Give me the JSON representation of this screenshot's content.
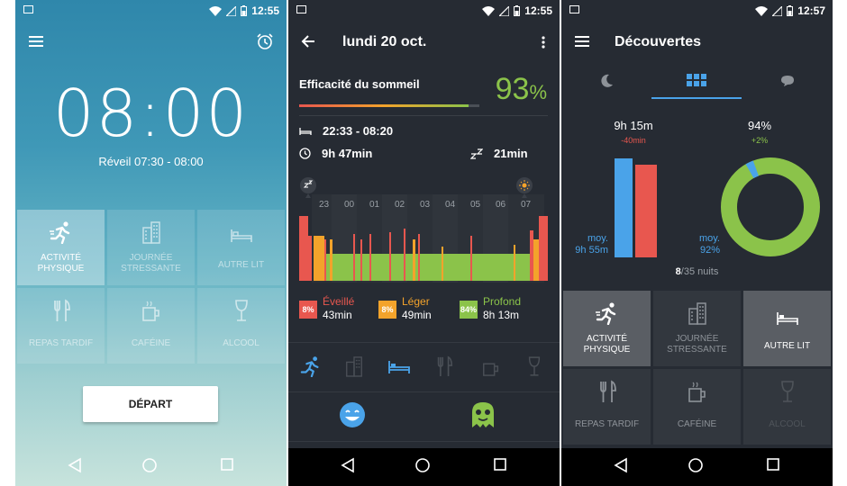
{
  "status": {
    "time1": "12:55",
    "time2": "12:55",
    "time3": "12:57"
  },
  "screen1": {
    "alarm_time": "08:00",
    "wake_window": "Réveil 07:30 - 08:00",
    "tiles": [
      {
        "label": "ACTIVITÉ PHYSIQUE",
        "icon": "running-icon",
        "active": true
      },
      {
        "label": "JOURNÉE STRESSANTE",
        "icon": "building-icon",
        "active": false
      },
      {
        "label": "AUTRE LIT",
        "icon": "bed-icon",
        "active": false
      },
      {
        "label": "REPAS TARDIF",
        "icon": "fork-knife-icon",
        "active": false
      },
      {
        "label": "CAFÉINE",
        "icon": "coffee-icon",
        "active": false
      },
      {
        "label": "ALCOOL",
        "icon": "wine-glass-icon",
        "active": false
      }
    ],
    "start_label": "DÉPART"
  },
  "screen2": {
    "title": "lundi 20 oct.",
    "efficiency_label": "Efficacité du sommeil",
    "efficiency_value": "93",
    "efficiency_unit": "%",
    "time_range": "22:33 - 08:20",
    "duration": "9h 47min",
    "fall_asleep": "21min",
    "hours": [
      "23",
      "00",
      "01",
      "02",
      "03",
      "04",
      "05",
      "06",
      "07"
    ],
    "legend": [
      {
        "pct": "8%",
        "name": "Éveillé",
        "time": "43min",
        "color": "#e8574f"
      },
      {
        "pct": "8%",
        "name": "Léger",
        "time": "49min",
        "color": "#f3a32b"
      },
      {
        "pct": "84%",
        "name": "Profond",
        "time": "8h 13m",
        "color": "#8bc34a"
      }
    ]
  },
  "screen3": {
    "title": "Découvertes",
    "duration_value": "9h 15m",
    "duration_delta": "-40min",
    "duration_avg_label": "moy.",
    "duration_avg": "9h 55m",
    "eff_value": "94%",
    "eff_delta": "+2%",
    "eff_avg_label": "moy.",
    "eff_avg": "92%",
    "nights_count": "8",
    "nights_total": "/35 nuits",
    "tiles": [
      {
        "label": "ACTIVITÉ PHYSIQUE",
        "icon": "running-icon",
        "state": "active"
      },
      {
        "label": "JOURNÉE STRESSANTE",
        "icon": "building-icon",
        "state": "normal"
      },
      {
        "label": "AUTRE LIT",
        "icon": "bed-icon",
        "state": "active"
      },
      {
        "label": "REPAS TARDIF",
        "icon": "fork-knife-icon",
        "state": "normal"
      },
      {
        "label": "CAFÉINE",
        "icon": "coffee-icon",
        "state": "normal"
      },
      {
        "label": "ALCOOL",
        "icon": "wine-glass-icon",
        "state": "dim"
      }
    ]
  },
  "colors": {
    "awake": "#e8574f",
    "light": "#f3a32b",
    "deep": "#8bc34a",
    "accent": "#4aa3e9"
  }
}
